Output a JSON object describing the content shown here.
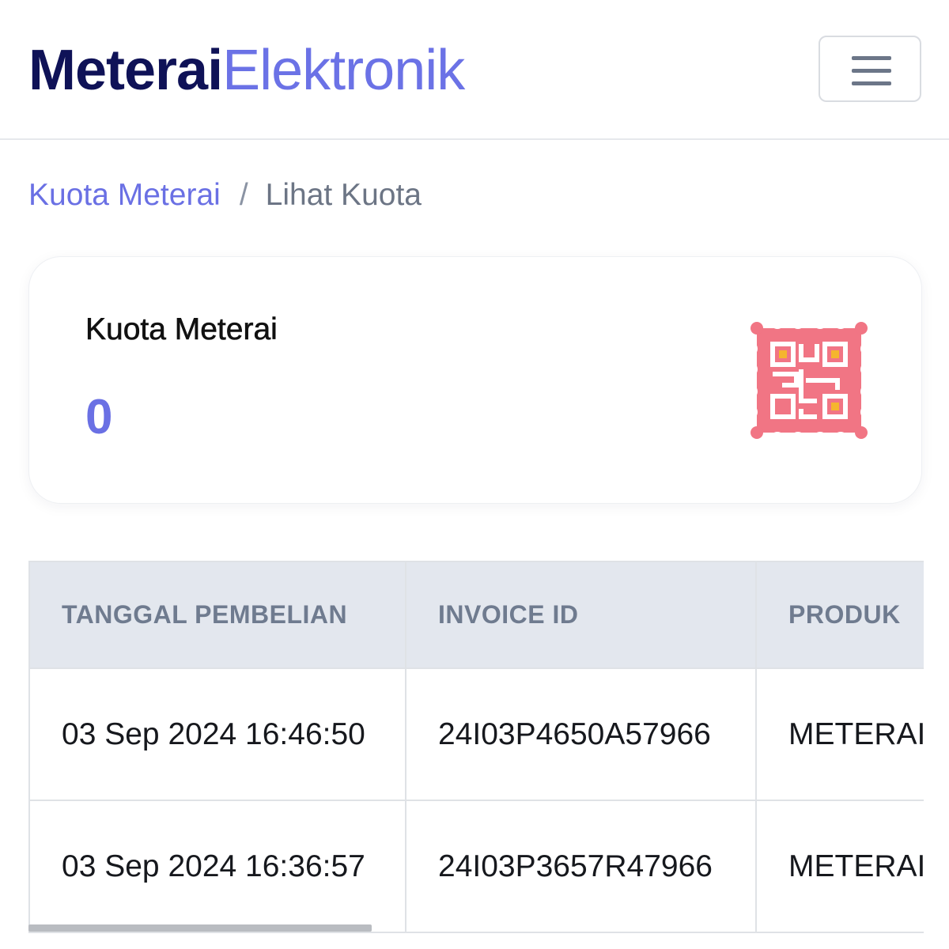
{
  "header": {
    "logo_bold": "Meterai",
    "logo_light": "Elektronik",
    "menu_icon": "hamburger-menu-icon"
  },
  "breadcrumb": {
    "parent": "Kuota Meterai",
    "separator": "/",
    "current": "Lihat Kuota"
  },
  "quota_card": {
    "title": "Kuota Meterai",
    "value": "0",
    "icon": "qr-stamp-icon",
    "icon_colors": {
      "stamp": "#f17584",
      "qr": "#ffffff",
      "accent": "#f5b52e"
    }
  },
  "table": {
    "columns": [
      "TANGGAL PEMBELIAN",
      "INVOICE ID",
      "PRODUK"
    ],
    "rows": [
      [
        "03 Sep 2024 16:46:50",
        "24I03P4650A57966",
        "METERAI"
      ],
      [
        "03 Sep 2024 16:36:57",
        "24I03P3657R47966",
        "METERAI"
      ]
    ]
  },
  "colors": {
    "brand_dark": "#0f1257",
    "brand_accent": "#6a70e4",
    "header_bg": "#e3e7ee"
  }
}
